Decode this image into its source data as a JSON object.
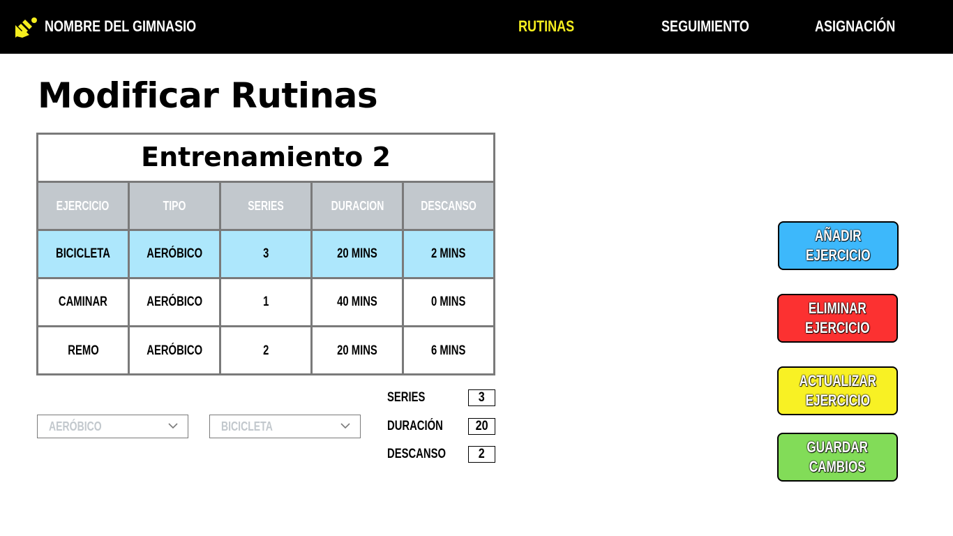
{
  "header": {
    "brand": "NOMBRE DEL GIMNASIO",
    "logo_icon": "logo-icon",
    "nav": [
      {
        "label": "RUTINAS",
        "active": true
      },
      {
        "label": "SEGUIMIENTO",
        "active": false
      },
      {
        "label": "ASIGNACIÓN",
        "active": false
      }
    ]
  },
  "page": {
    "title": "Modificar Rutinas"
  },
  "routine": {
    "title": "Entrenamiento 2",
    "columns": [
      "EJERCICIO",
      "TIPO",
      "SERIES",
      "DURACION",
      "DESCANSO"
    ],
    "rows": [
      [
        "BICICLETA",
        "AERÓBICO",
        "3",
        "20 MINS",
        "2 MINS"
      ],
      [
        "CAMINAR",
        "AERÓBICO",
        "1",
        "40 MINS",
        "0 MINS"
      ],
      [
        "REMO",
        "AERÓBICO",
        "2",
        "20 MINS",
        "6 MINS"
      ]
    ],
    "selected_row": 0
  },
  "editor": {
    "type_select": {
      "value": "AERÓBICO",
      "icon": "chevron-down-icon"
    },
    "exercise_select": {
      "value": "BICICLETA",
      "icon": "chevron-down-icon"
    },
    "series": {
      "label": "SERIES",
      "value": "3"
    },
    "duration": {
      "label": "DURACIÓN",
      "value": "20"
    },
    "rest": {
      "label": "DESCANSO",
      "value": "2"
    }
  },
  "actions": {
    "add": {
      "label": "AÑADIR\nEJERCICIO",
      "color": "#3db8fb"
    },
    "delete": {
      "label": "ELIMINAR\nEJERCICIO",
      "color": "#fc3131"
    },
    "update": {
      "label": "ACTUALIZAR\nEJERCICIO",
      "color": "#f8f124"
    },
    "save": {
      "label": "GUARDAR\nCAMBIOS",
      "color": "#82dc58"
    }
  },
  "colors": {
    "topbar": "#000000",
    "nav_active": "#f5ee1e",
    "table_header": "#c2c8cd",
    "selected_row": "#ade7fc",
    "border": "#7a7a7a"
  }
}
